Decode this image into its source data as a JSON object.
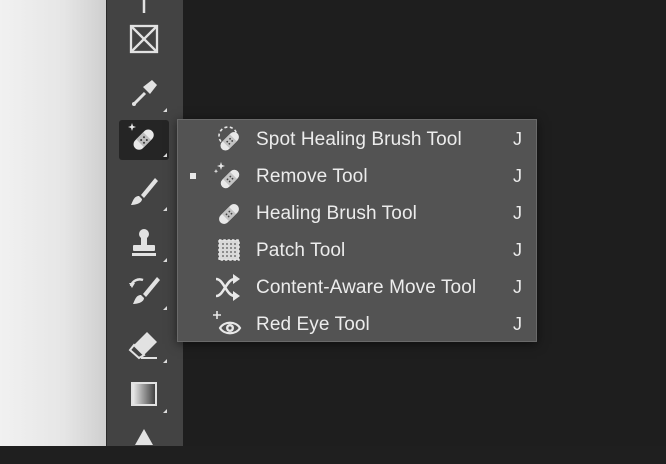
{
  "flyout_menu": {
    "items": [
      {
        "label": "Spot Healing Brush Tool",
        "shortcut": "J",
        "icon": "spot-healing-brush-icon",
        "selected": false
      },
      {
        "label": "Remove Tool",
        "shortcut": "J",
        "icon": "remove-tool-icon",
        "selected": true
      },
      {
        "label": "Healing Brush Tool",
        "shortcut": "J",
        "icon": "healing-brush-icon",
        "selected": false
      },
      {
        "label": "Patch Tool",
        "shortcut": "J",
        "icon": "patch-tool-icon",
        "selected": false
      },
      {
        "label": "Content-Aware Move Tool",
        "shortcut": "J",
        "icon": "content-aware-move-icon",
        "selected": false
      },
      {
        "label": "Red Eye Tool",
        "shortcut": "J",
        "icon": "red-eye-icon",
        "selected": false
      }
    ]
  },
  "toolbar": {
    "tools": [
      "frame-tool-icon",
      "eyedropper-tool-icon",
      "remove-tool-icon",
      "brush-tool-icon",
      "clone-stamp-tool-icon",
      "history-brush-tool-icon",
      "eraser-tool-icon",
      "gradient-tool-icon"
    ]
  },
  "colors": {
    "toolbar_bg": "#434343",
    "menu_bg": "#535353",
    "text": "#ececec",
    "canvas_bg": "#1e1e1e"
  }
}
